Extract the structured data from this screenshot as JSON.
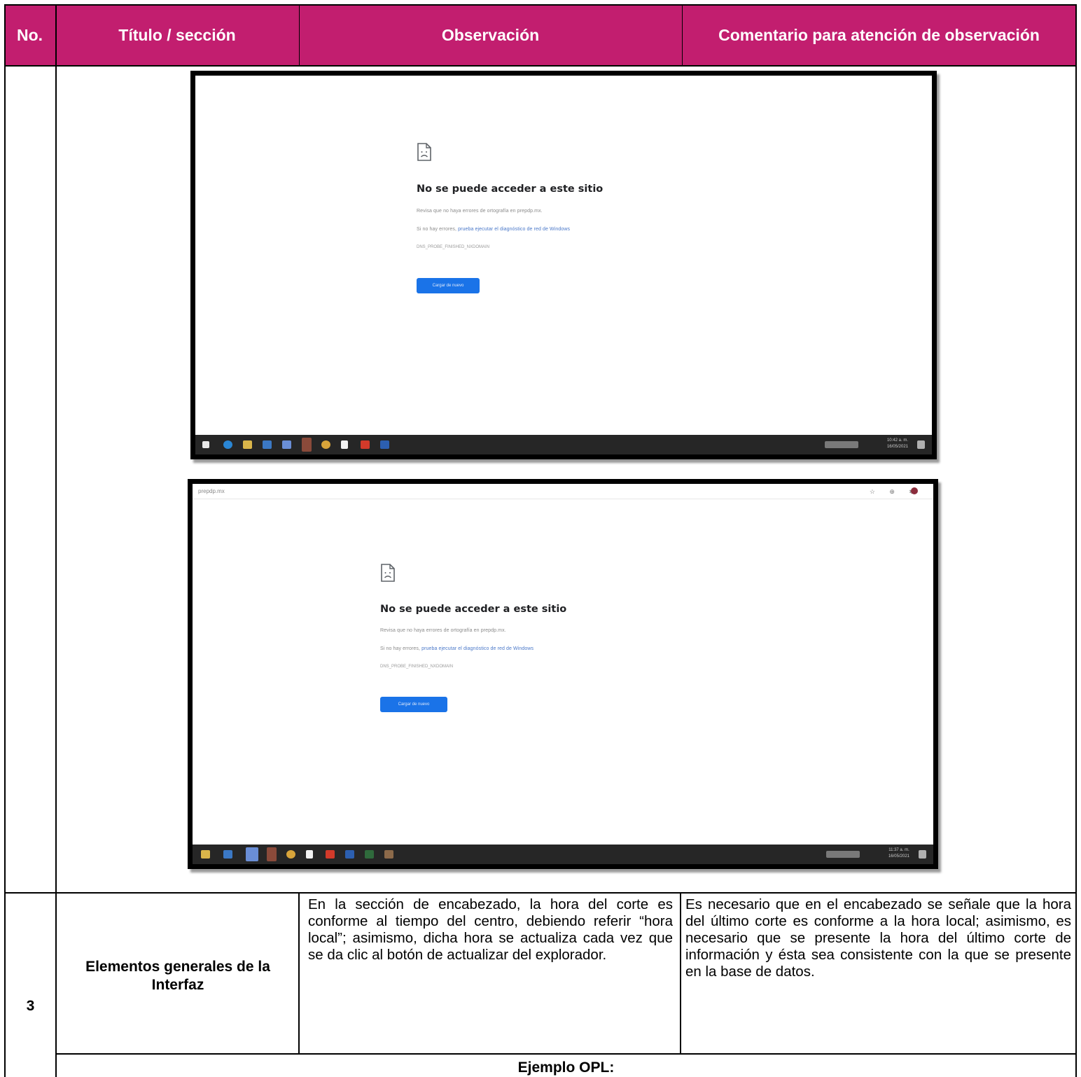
{
  "header": {
    "col_no": "No.",
    "col_title": "Título / sección",
    "col_observation": "Observación",
    "col_comment": "Comentario para atención de observación",
    "bg_color": "#c21e6f"
  },
  "screenshot1": {
    "error_title": "No se puede acceder a este sitio",
    "line1": "Revisa que no haya errores de ortografía en prepdp.mx.",
    "line2_prefix": "Si no hay errores, ",
    "line2_link": "prueba ejecutar el diagnóstico de red de Windows",
    "error_code": "DNS_PROBE_FINISHED_NXDOMAIN",
    "button": "Cargar de nuevo",
    "clock_time": "10:42 a. m.",
    "clock_date": "16/05/2021"
  },
  "screenshot2": {
    "url": "prepdp.mx",
    "error_title": "No se puede acceder a este sitio",
    "line1": "Revisa que no haya errores de ortografía en prepdp.mx.",
    "line2_prefix": "Si no hay errores, ",
    "line2_link": "prueba ejecutar el diagnóstico de red de Windows",
    "error_code": "DNS_PROBE_FINISHED_NXDOMAIN",
    "button": "Cargar de nuevo",
    "clock_time": "11:37 a. m.",
    "clock_date": "16/05/2021"
  },
  "row3": {
    "number": "3",
    "title": "Elementos generales de la Interfaz",
    "observation": "En la sección de encabezado, la hora del corte es conforme al tiempo del centro, debiendo referir “hora local”; asimismo, dicha hora se actualiza cada vez que se da clic al botón de actualizar del explorador.",
    "comment": "Es necesario que en el encabezado se señale que la hora del último corte es conforme a la hora local; asimismo, es necesario que se presente la hora del último corte de información y ésta sea consistente con la que se presente en la base de datos."
  },
  "example_label": "Ejemplo OPL:"
}
